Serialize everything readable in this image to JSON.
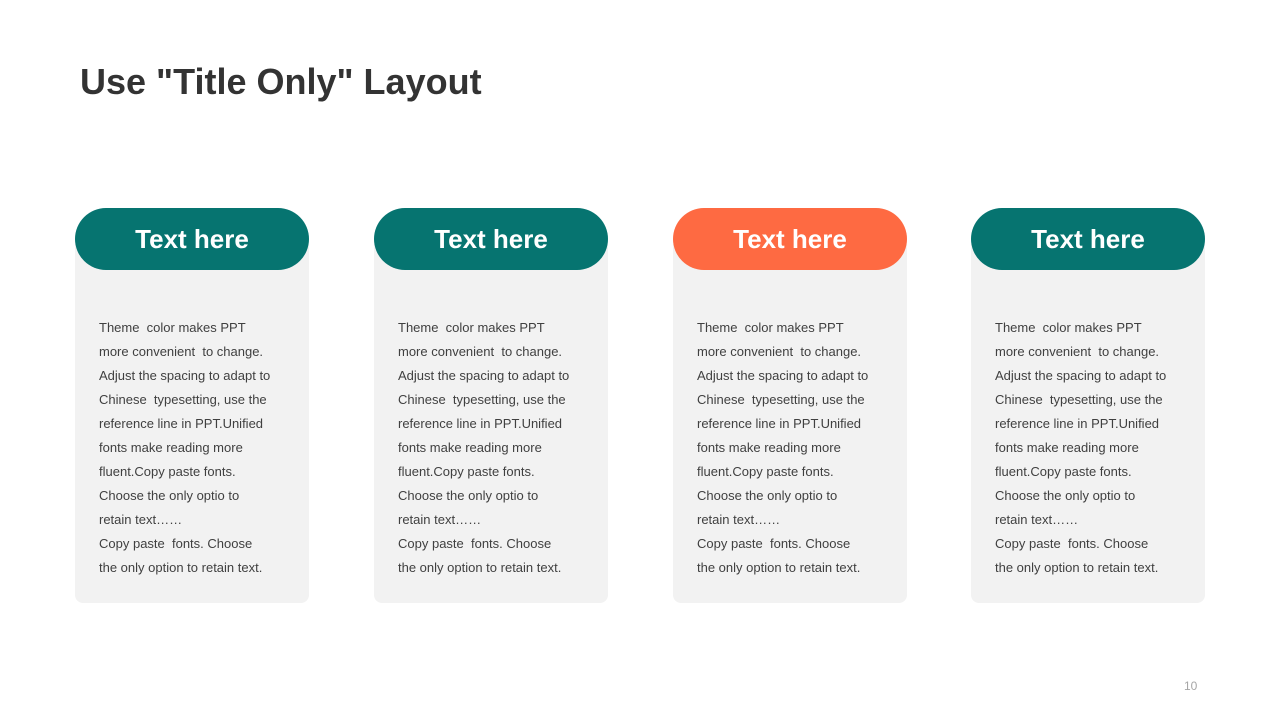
{
  "slide": {
    "title": "Use \"Title Only\" Layout",
    "page_number": "10"
  },
  "colors": {
    "teal": "#067470",
    "orange": "#fe6a42",
    "card_background": "#f2f2f2",
    "title_text": "#333333",
    "body_text": "#404040"
  },
  "cards": [
    {
      "header": "Text here",
      "header_color": "teal",
      "lines": [
        "Theme  color makes PPT",
        "more convenient  to change.",
        "Adjust the spacing to adapt to",
        "Chinese  typesetting, use the",
        "reference line in PPT.Unified",
        "fonts make reading more",
        "fluent.Copy paste fonts.",
        "Choose the only optio to",
        "retain text……",
        "Copy paste  fonts. Choose",
        "the only option to retain text."
      ]
    },
    {
      "header": "Text here",
      "header_color": "teal",
      "lines": [
        "Theme  color makes PPT",
        "more convenient  to change.",
        "Adjust the spacing to adapt to",
        "Chinese  typesetting, use the",
        "reference line in PPT.Unified",
        "fonts make reading more",
        "fluent.Copy paste fonts.",
        "Choose the only optio to",
        "retain text……",
        "Copy paste  fonts. Choose",
        "the only option to retain text."
      ]
    },
    {
      "header": "Text here",
      "header_color": "orange",
      "lines": [
        "Theme  color makes PPT",
        "more convenient  to change.",
        "Adjust the spacing to adapt to",
        "Chinese  typesetting, use the",
        "reference line in PPT.Unified",
        "fonts make reading more",
        "fluent.Copy paste fonts.",
        "Choose the only optio to",
        "retain text……",
        "Copy paste  fonts. Choose",
        "the only option to retain text."
      ]
    },
    {
      "header": "Text here",
      "header_color": "teal",
      "lines": [
        "Theme  color makes PPT",
        "more convenient  to change.",
        "Adjust the spacing to adapt to",
        "Chinese  typesetting, use the",
        "reference line in PPT.Unified",
        "fonts make reading more",
        "fluent.Copy paste fonts.",
        "Choose the only optio to",
        "retain text……",
        "Copy paste  fonts. Choose",
        "the only option to retain text."
      ]
    }
  ]
}
